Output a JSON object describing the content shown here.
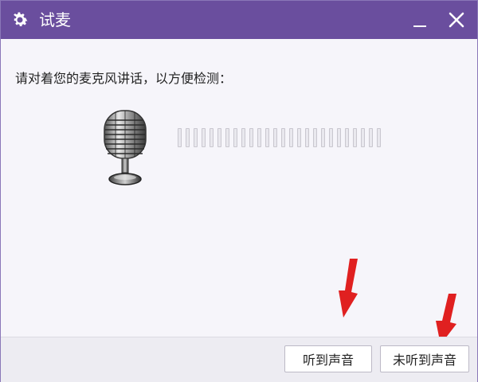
{
  "window": {
    "title": "试麦",
    "title_icon": "gear-icon",
    "controls": {
      "minimize": "minimize-icon",
      "close": "close-icon"
    }
  },
  "main": {
    "prompt": "请对着您的麦克风讲话，以方便检测：",
    "mic_icon": "microphone-icon",
    "level_meter": {
      "segments": 26,
      "active": 0
    }
  },
  "footer": {
    "heard_label": "听到声音",
    "not_heard_label": "未听到声音"
  },
  "annotations": {
    "arrow_color": "#e02020"
  },
  "colors": {
    "titlebar": "#6a4e9e",
    "background": "#f6f5fa"
  }
}
